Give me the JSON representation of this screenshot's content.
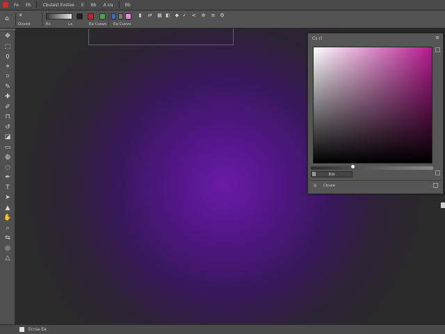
{
  "menubar": {
    "items": [
      "Fe",
      "Eb",
      "Cbutest Exstee",
      "E",
      "Bb",
      "A Ua",
      "Bb"
    ]
  },
  "options": {
    "tool_label": "Dsvod",
    "opt_text_1": "Ex",
    "opt_text_2": "Lx",
    "opt_text_3": "Ea Cusvo",
    "opt_text_4": "Cu",
    "opt_text_5": "Eb",
    "colors": {
      "white_btn": "#e6e6e6",
      "black_btn": "#1e1e1e",
      "red_btn": "#c42424",
      "green_btn": "#4fa34f",
      "blue_btn": "#3a6fcf",
      "gray_btn": "#7a7a7a",
      "pink_btn": "#e889e0"
    }
  },
  "toolbar": {
    "tools": [
      "move-tool",
      "marquee-tool",
      "lasso-tool",
      "quick-select-tool",
      "crop-tool",
      "eyedropper-tool",
      "healing-tool",
      "brush-tool",
      "stamp-tool",
      "history-brush-tool",
      "eraser-tool",
      "gradient-tool",
      "blur-tool",
      "dodge-tool",
      "pen-tool",
      "type-tool",
      "path-select-tool",
      "shape-tool",
      "hand-tool",
      "zoom-tool",
      "color-swap",
      "quick-mask",
      "screen-mode"
    ]
  },
  "panel": {
    "title": "Cs cl",
    "hue_value": "B|b",
    "footer_label": "Cbuse",
    "colors": {
      "hue": "#b5198f"
    }
  },
  "status": {
    "text": "Ecrsa Ea"
  },
  "canvas": {
    "colors": {
      "center": "#6a1aa8",
      "edge": "#2a2a2a"
    }
  }
}
